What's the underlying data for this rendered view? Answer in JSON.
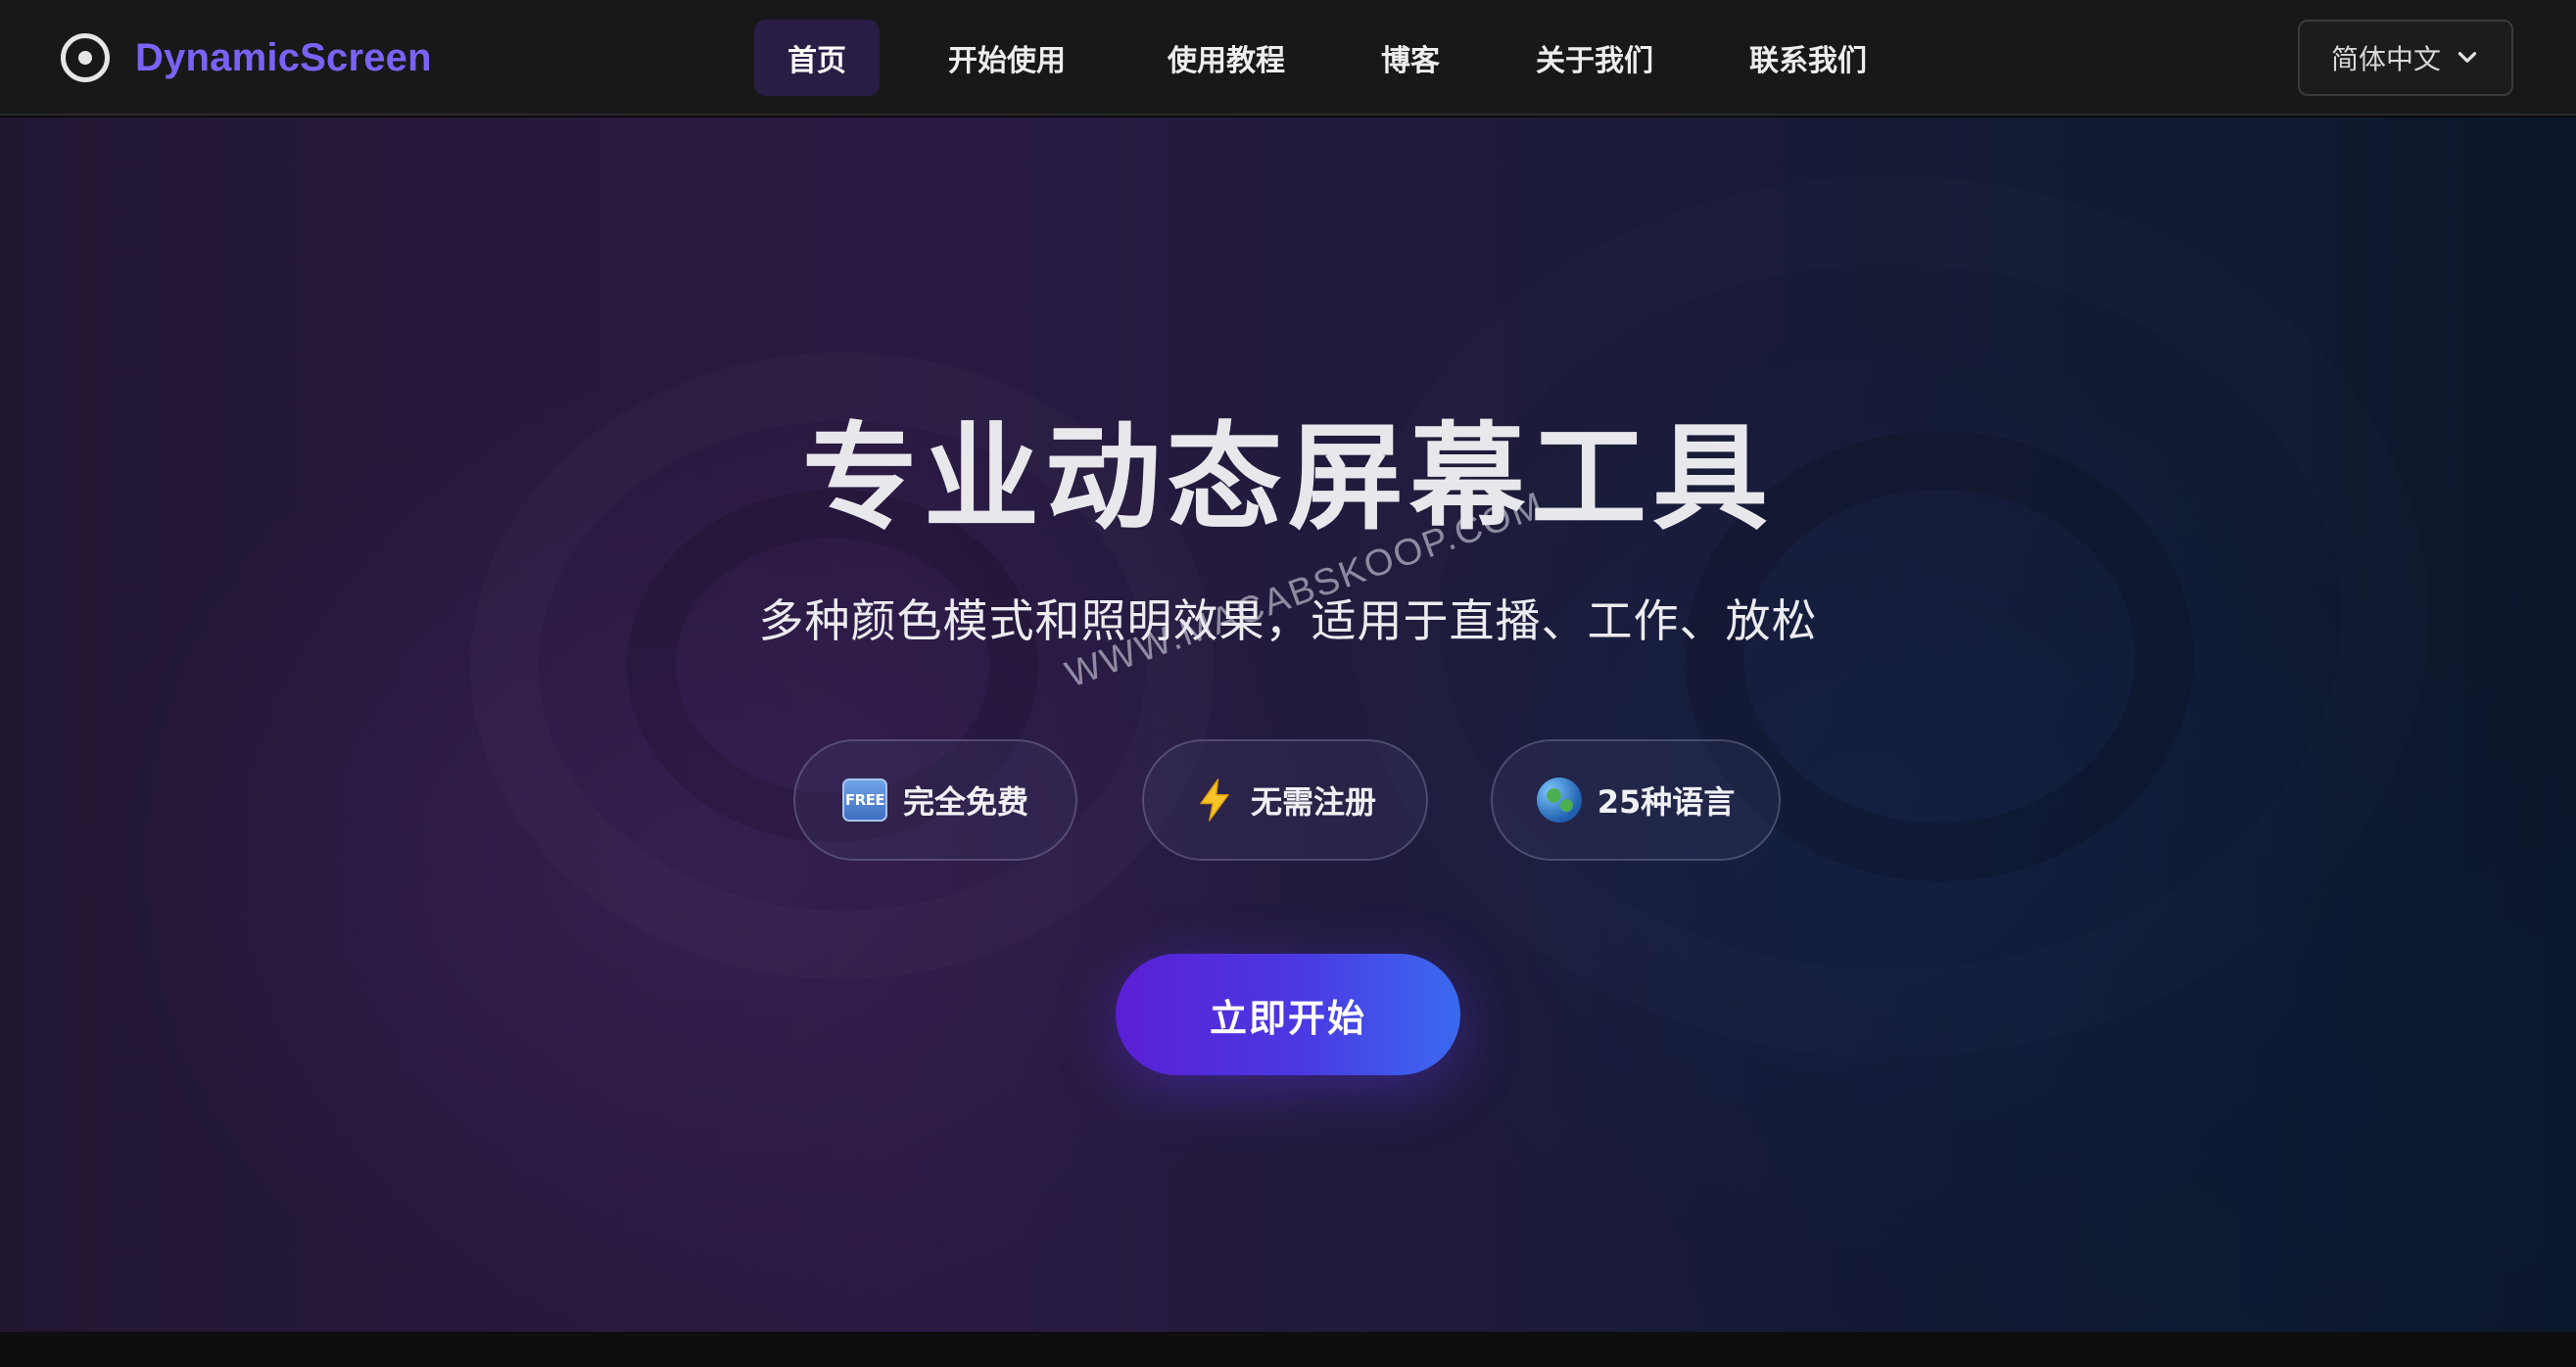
{
  "brand": {
    "name": "DynamicScreen",
    "icon": "radio-target-icon",
    "color": "#7b62f5"
  },
  "nav": {
    "items": [
      {
        "label": "首页",
        "active": true
      },
      {
        "label": "开始使用",
        "active": false
      },
      {
        "label": "使用教程",
        "active": false
      },
      {
        "label": "博客",
        "active": false
      },
      {
        "label": "关于我们",
        "active": false
      },
      {
        "label": "联系我们",
        "active": false
      }
    ]
  },
  "language": {
    "selected": "简体中文",
    "icon": "chevron-down-icon"
  },
  "hero": {
    "title": "专业动态屏幕工具",
    "subtitle": "多种颜色模式和照明效果，适用于直播、工作、放松",
    "watermark": "WWW.MACABSKOOP.COM",
    "badges": [
      {
        "icon": "free-icon",
        "icon_text": "FREE",
        "label": "完全免费"
      },
      {
        "icon": "lightning-bolt-icon",
        "label": "无需注册"
      },
      {
        "icon": "globe-icon",
        "label": "25种语言"
      }
    ],
    "cta_label": "立即开始"
  },
  "colors": {
    "accent": "#7b62f5",
    "cta_start": "#5b1fd6",
    "cta_end": "#3a6af0",
    "nav_active_bg": "#2a1d45"
  }
}
